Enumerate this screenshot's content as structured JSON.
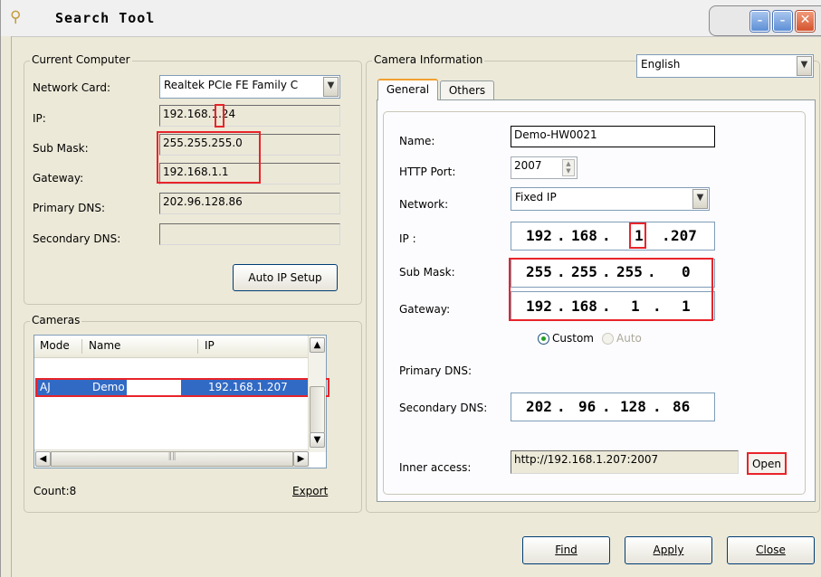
{
  "window": {
    "title": "Search Tool"
  },
  "title_controls": {
    "minimize": "–",
    "restore": "–",
    "close": "✕"
  },
  "current_computer": {
    "legend": "Current Computer",
    "network_card_label": "Network Card:",
    "network_card_value": "Realtek PCIe FE Family C",
    "ip_label": "IP:",
    "ip_value": "192.168.1.24",
    "submask_label": "Sub Mask:",
    "submask_value": "255.255.255.0",
    "gateway_label": "Gateway:",
    "gateway_value": "192.168.1.1",
    "primary_dns_label": "Primary DNS:",
    "primary_dns_value": "202.96.128.86",
    "secondary_dns_label": "Secondary DNS:",
    "secondary_dns_value": "",
    "auto_ip_button": "Auto IP Setup"
  },
  "cameras": {
    "legend": "Cameras",
    "columns": [
      "Mode",
      "Name",
      "IP"
    ],
    "rows": [
      {
        "mode": "AJ",
        "name": "Demo",
        "ip": "192.168.1.207",
        "selected": true
      }
    ],
    "count_label": "Count:8",
    "export_button": "Export"
  },
  "camera_information": {
    "legend": "Camera Information",
    "language": "English",
    "tabs": [
      "General",
      "Others"
    ],
    "active_tab": "General",
    "name_label": "Name:",
    "name_value": "Demo-HW0021",
    "http_port_label": "HTTP Port:",
    "http_port_value": "2007",
    "network_label": "Network:",
    "network_value": "Fixed IP",
    "ip_label": "IP :",
    "ip_octets": [
      "192",
      "168",
      "1",
      "207"
    ],
    "submask_label": "Sub Mask:",
    "submask_octets": [
      "255",
      "255",
      "255",
      "0"
    ],
    "gateway_label": "Gateway:",
    "gateway_octets": [
      "192",
      "168",
      "1",
      "1"
    ],
    "mode_custom": "Custom",
    "mode_auto": "Auto",
    "primary_dns_label": "Primary DNS:",
    "secondary_dns_label": "Secondary DNS:",
    "dns_octets": [
      "202",
      "96",
      "128",
      "86"
    ],
    "inner_access_label": "Inner access:",
    "inner_access_value": "http://192.168.1.207:2007",
    "open_button": "Open"
  },
  "footer": {
    "find_button": "Find",
    "apply_button": "Apply",
    "close_button": "Close"
  },
  "colors": {
    "highlight": "#e8242a",
    "selection": "#316ac5",
    "window_bg": "#ece9d8"
  }
}
